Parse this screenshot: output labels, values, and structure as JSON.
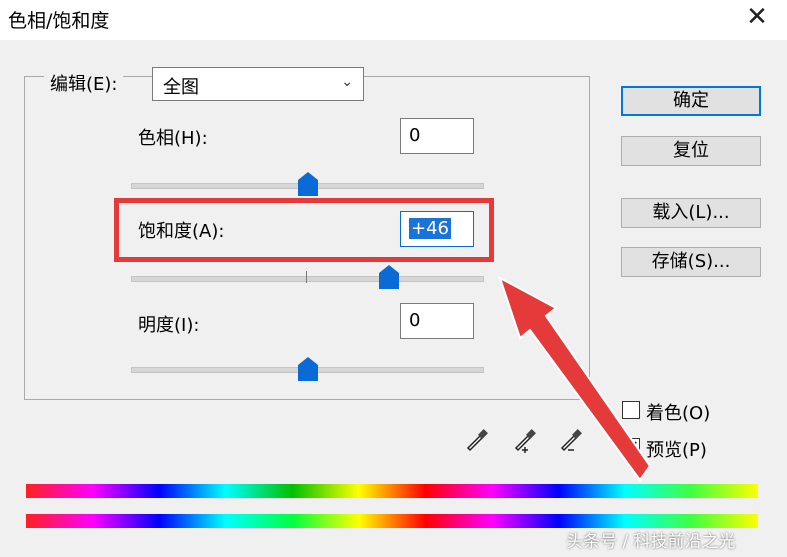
{
  "window": {
    "title": "色相/饱和度",
    "close_glyph": "✕"
  },
  "edit": {
    "label": "编辑(E):",
    "selected": "全图"
  },
  "controls": {
    "hue": {
      "label": "色相(H):",
      "value": "0",
      "slider_value": 0,
      "slider_min": -180,
      "slider_max": 180
    },
    "saturation": {
      "label": "饱和度(A):",
      "value": "+46",
      "slider_value": 46,
      "slider_min": -100,
      "slider_max": 100
    },
    "lightness": {
      "label": "明度(I):",
      "value": "0",
      "slider_value": 0,
      "slider_min": -100,
      "slider_max": 100
    }
  },
  "buttons": {
    "ok": "确定",
    "reset": "复位",
    "load": "载入(L)...",
    "save": "存储(S)..."
  },
  "options": {
    "colorize": {
      "label": "着色(O)",
      "checked": false
    },
    "preview": {
      "label": "预览(P)",
      "checked": true
    }
  },
  "icons": [
    "eyedropper-icon",
    "eyedropper-plus-icon",
    "eyedropper-minus-icon"
  ],
  "watermark": "头条号 / 科技前沿之光",
  "colors": {
    "accent": "#0a6bd6",
    "annotation": "#e53a3a"
  }
}
